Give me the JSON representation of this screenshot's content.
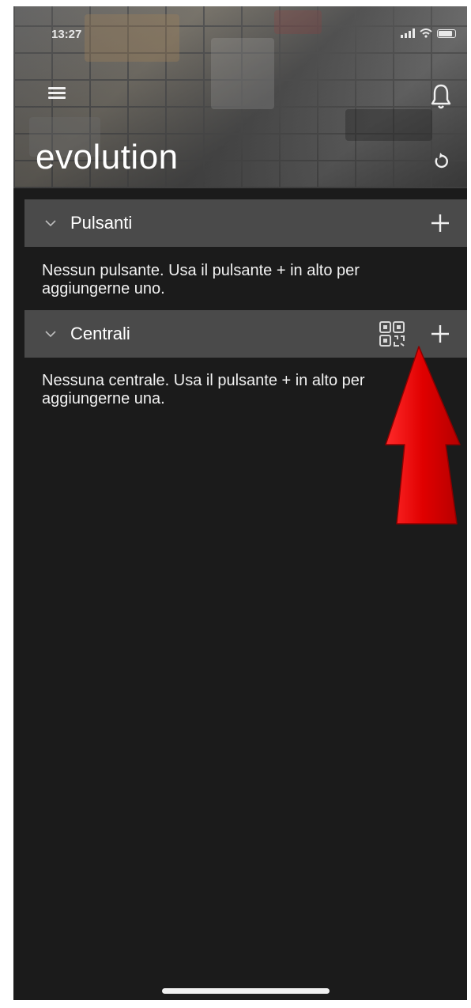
{
  "status_bar": {
    "time": "13:27"
  },
  "header": {
    "title": "evolution",
    "menu_icon": "hamburger-icon",
    "bell_icon": "bell-icon",
    "refresh_icon": "refresh-icon"
  },
  "sections": [
    {
      "label": "Pulsanti",
      "empty_message": "Nessun pulsante. Usa il pulsante + in alto per aggiungerne uno."
    },
    {
      "label": "Centrali",
      "empty_message": "Nessuna centrale. Usa il pulsante + in alto per aggiungerne una."
    }
  ],
  "colors": {
    "background": "#1b1b1b",
    "section_header": "#4a4a4a",
    "text": "#ffffff",
    "arrow": "#e00000"
  }
}
